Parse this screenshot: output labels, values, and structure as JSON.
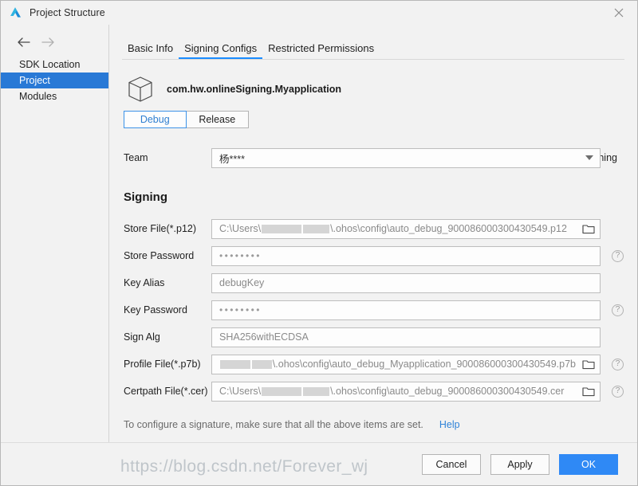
{
  "window": {
    "title": "Project Structure",
    "logo_icon": "hdc-triangle-logo",
    "close_icon": "close-icon"
  },
  "sidebar": {
    "back_icon": "arrow-left-icon",
    "forward_icon": "arrow-right-icon",
    "items": [
      {
        "label": "SDK Location",
        "selected": false
      },
      {
        "label": "Project",
        "selected": true
      },
      {
        "label": "Modules",
        "selected": false
      }
    ]
  },
  "tabs": [
    {
      "label": "Basic Info",
      "active": false
    },
    {
      "label": "Signing Configs",
      "active": true
    },
    {
      "label": "Restricted Permissions",
      "active": false
    }
  ],
  "package": {
    "icon": "cube-icon",
    "name": "com.hw.onlineSigning.Myapplication"
  },
  "build_variants": [
    {
      "label": "Debug",
      "active": true
    },
    {
      "label": "Release",
      "active": false
    }
  ],
  "auto_signing": {
    "label": "Automatically generate signing",
    "checked": true,
    "check_icon": "checkmark-icon"
  },
  "team": {
    "label": "Team",
    "value": "杨****",
    "dropdown_icon": "chevron-down-icon"
  },
  "signing": {
    "section_title": "Signing",
    "fields": [
      {
        "label": "Store File(*.p12)",
        "value_prefix": "C:\\Users\\",
        "redacted": true,
        "value_suffix": "\\.ohos\\config\\auto_debug_900086000300430549.p12",
        "browse_icon": "folder-icon",
        "has_browse": true,
        "has_help": false,
        "type": "path"
      },
      {
        "label": "Store Password",
        "value": "••••••••",
        "has_browse": false,
        "has_help": true,
        "help_icon": "question-circle-icon",
        "type": "password"
      },
      {
        "label": "Key Alias",
        "value": "debugKey",
        "has_browse": false,
        "has_help": false,
        "type": "text"
      },
      {
        "label": "Key Password",
        "value": "••••••••",
        "has_browse": false,
        "has_help": true,
        "help_icon": "question-circle-icon",
        "type": "password"
      },
      {
        "label": "Sign Alg",
        "value": "SHA256withECDSA",
        "has_browse": false,
        "has_help": false,
        "type": "text"
      },
      {
        "label": "Profile File(*.p7b)",
        "value_prefix": "",
        "redacted": true,
        "value_suffix": "\\.ohos\\config\\auto_debug_Myapplication_900086000300430549.p7b",
        "browse_icon": "folder-icon",
        "has_browse": true,
        "has_help": true,
        "help_icon": "question-circle-icon",
        "type": "path"
      },
      {
        "label": "Certpath File(*.cer)",
        "value_prefix": "C:\\Users\\",
        "redacted": true,
        "value_suffix": "\\.ohos\\config\\auto_debug_900086000300430549.cer",
        "browse_icon": "folder-icon",
        "has_browse": true,
        "has_help": true,
        "help_icon": "question-circle-icon",
        "type": "path"
      }
    ]
  },
  "hint": {
    "text": "To configure a signature, make sure that all the above items are set.",
    "help_link": "Help"
  },
  "footer": {
    "cancel": "Cancel",
    "apply": "Apply",
    "ok": "OK"
  },
  "watermark": "https://blog.csdn.net/Forever_wj",
  "colors": {
    "accent": "#1a8cff",
    "selection": "#2979d6",
    "primary_button": "#2f89f5",
    "link": "#2f83d8"
  }
}
